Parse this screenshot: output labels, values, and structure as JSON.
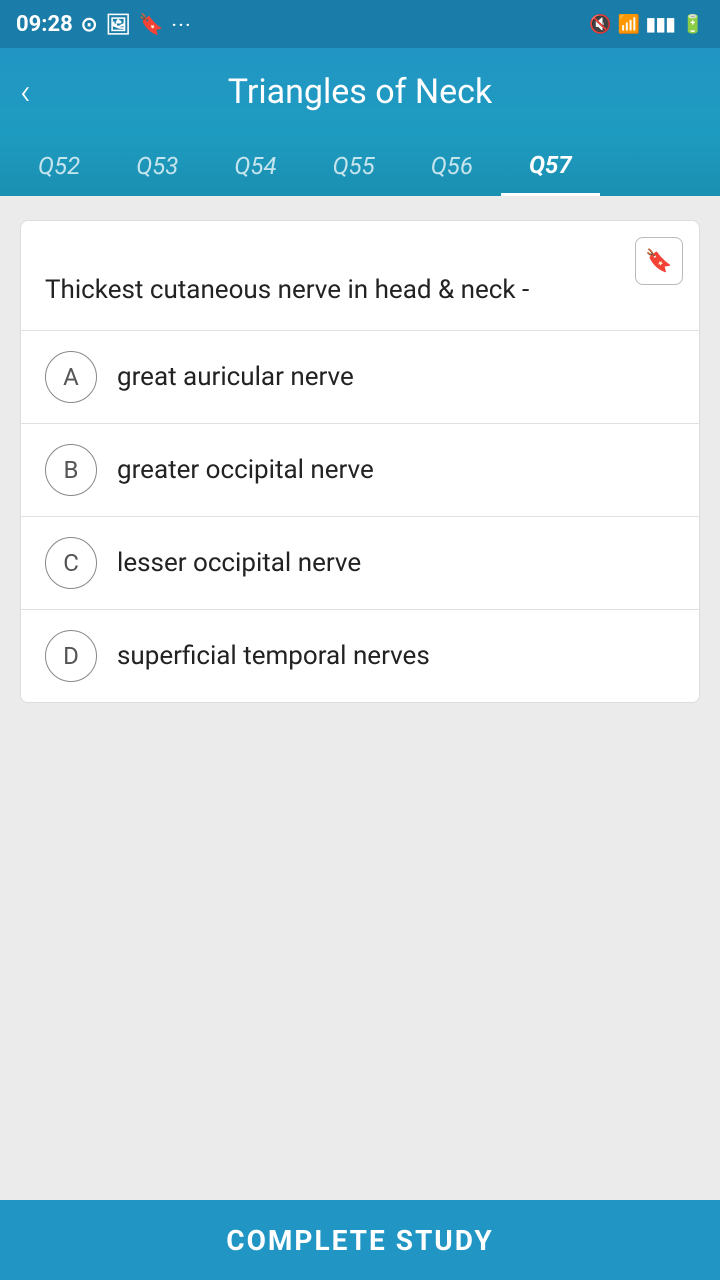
{
  "statusBar": {
    "time": "09:28",
    "icons": [
      "mute",
      "wifi",
      "signal",
      "battery"
    ]
  },
  "header": {
    "title": "Triangles of Neck",
    "back_label": "‹"
  },
  "tabs": [
    {
      "id": "q52",
      "label": "Q52",
      "active": false
    },
    {
      "id": "q53",
      "label": "Q53",
      "active": false
    },
    {
      "id": "q54",
      "label": "Q54",
      "active": false
    },
    {
      "id": "q55",
      "label": "Q55",
      "active": false
    },
    {
      "id": "q56",
      "label": "Q56",
      "active": false
    },
    {
      "id": "q57",
      "label": "Q57",
      "active": true
    }
  ],
  "question": {
    "text": "Thickest cutaneous nerve in head & neck -"
  },
  "options": [
    {
      "id": "A",
      "text": "great auricular nerve"
    },
    {
      "id": "B",
      "text": "greater occipital nerve"
    },
    {
      "id": "C",
      "text": "lesser occipital nerve"
    },
    {
      "id": "D",
      "text": "superficial temporal nerves"
    }
  ],
  "bottomBar": {
    "label": "COMPLETE STUDY"
  }
}
